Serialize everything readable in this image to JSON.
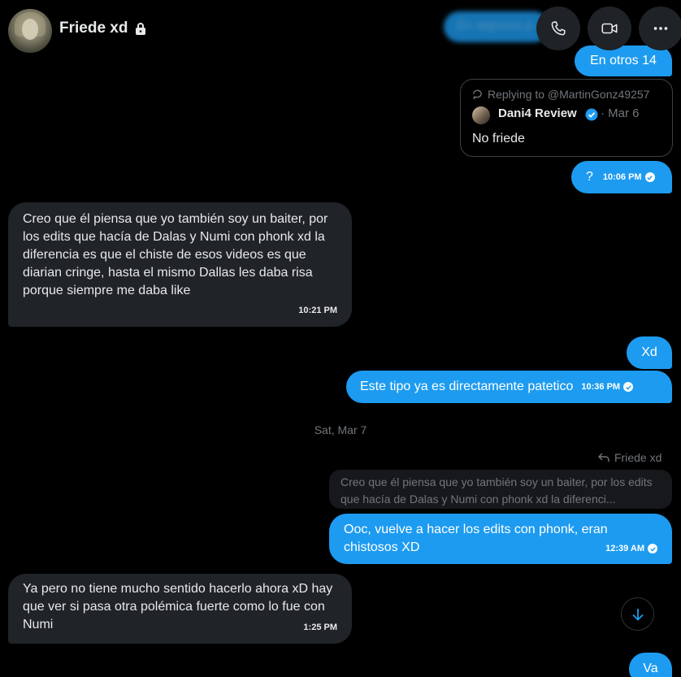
{
  "header": {
    "name": "Friede xd",
    "ghost_text": "En algunos p"
  },
  "colors": {
    "accent": "#1d9bf0",
    "received_bg": "#202327",
    "muted": "#71767b"
  },
  "icons": [
    "lock-icon",
    "phone-icon",
    "video-icon",
    "more-icon",
    "reply-icon",
    "verified-icon",
    "check-icon",
    "arrow-down-icon"
  ],
  "messages": {
    "m1": {
      "text": "En otros 14"
    },
    "reply_card": {
      "replying_to": "Replying to @MartinGonz49257",
      "author": "Dani4 Review",
      "date": "· Mar 6",
      "text": "No friede"
    },
    "m2": {
      "text": "?",
      "time": "10:06 PM"
    },
    "m3": {
      "text": "Creo que él piensa que yo también soy un baiter, por los edits que hacía de Dalas y Numi con phonk xd la diferencia es que el chiste de esos videos es que diarian cringe, hasta el mismo Dallas les daba risa porque siempre me daba like",
      "time": "10:21 PM"
    },
    "m4": {
      "text": "Xd"
    },
    "m5": {
      "text": "Este tipo ya es directamente patetico",
      "time": "10:36 PM"
    },
    "date_separator": "Sat, Mar 7",
    "reply_label": "Friede xd",
    "quoted_text": "Creo que él piensa que yo también soy un baiter, por los edits que hacía de Dalas y Numi con phonk xd la diferenci...",
    "m6": {
      "text": "Ooc, vuelve a hacer los edits con phonk,  eran chistosos XD",
      "time": "12:39 AM"
    },
    "m7": {
      "text": "Ya pero no tiene mucho sentido hacerlo ahora xD hay que ver si pasa otra polémica fuerte como lo fue con Numi",
      "time": "1:25 PM"
    },
    "m8": {
      "text": "Va"
    }
  }
}
